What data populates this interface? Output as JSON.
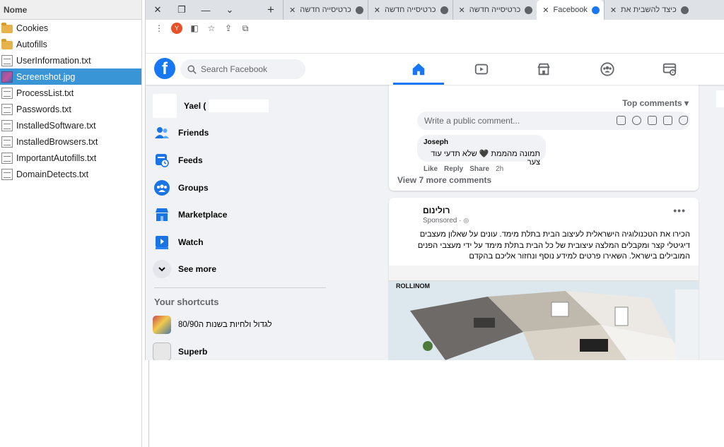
{
  "file_manager": {
    "header": "Nome",
    "items": [
      {
        "name": "Cookies",
        "type": "folder"
      },
      {
        "name": "Autofills",
        "type": "folder"
      },
      {
        "name": "UserInformation.txt",
        "type": "text"
      },
      {
        "name": "Screenshot.jpg",
        "type": "image",
        "selected": true
      },
      {
        "name": "ProcessList.txt",
        "type": "text"
      },
      {
        "name": "Passwords.txt",
        "type": "text"
      },
      {
        "name": "InstalledSoftware.txt",
        "type": "text"
      },
      {
        "name": "InstalledBrowsers.txt",
        "type": "text"
      },
      {
        "name": "ImportantAutofills.txt",
        "type": "text"
      },
      {
        "name": "DomainDetects.txt",
        "type": "text"
      }
    ]
  },
  "browser": {
    "tabs": [
      {
        "label": "כרטיסייה חדשה",
        "active": false
      },
      {
        "label": "כרטיסייה חדשה",
        "active": false
      },
      {
        "label": "כרטיסייה חדשה",
        "active": false
      },
      {
        "label": "Facebook",
        "active": true
      },
      {
        "label": "כיצד להשבית את",
        "active": false
      }
    ],
    "new_tab": "+",
    "profile_letter": "Y"
  },
  "facebook": {
    "logo": "f",
    "search_placeholder": "Search Facebook",
    "user_name": "Yael (",
    "menu": [
      "Friends",
      "Feeds",
      "Groups",
      "Marketplace",
      "Watch",
      "See more"
    ],
    "shortcuts_title": "Your shortcuts",
    "shortcuts": [
      "לגדול ולחיות בשנות ה80/90",
      "Superb"
    ],
    "post": {
      "top_comments": "Top comments",
      "comment_placeholder": "Write a public comment...",
      "comment": {
        "author": "Joseph",
        "text": "תמונה מהממת 🖤 שלא תדעי עוד צער",
        "like": "Like",
        "reply": "Reply",
        "share": "Share",
        "time": "2h"
      },
      "view_more": "View 7 more comments"
    },
    "ad": {
      "advertiser": "רולינום",
      "sponsored": "Sponsored · ",
      "text": "הכירו את הטכנולוגיה הישראלית לעיצוב הבית בתלת מימד. עונים על שאלון מעצבים דיגיטלי קצר ומקבלים המלצה עיצובית של כל הבית בתלת מימד על ידי מעצבי הפנים המובילים בישראל. השאירו פרטים למידע נוסף ונחזור אליכם בהקדם",
      "image_logo": "ROLLINOM"
    },
    "colors": {
      "brand": "#1877f2",
      "background": "#f0f2f5"
    }
  }
}
